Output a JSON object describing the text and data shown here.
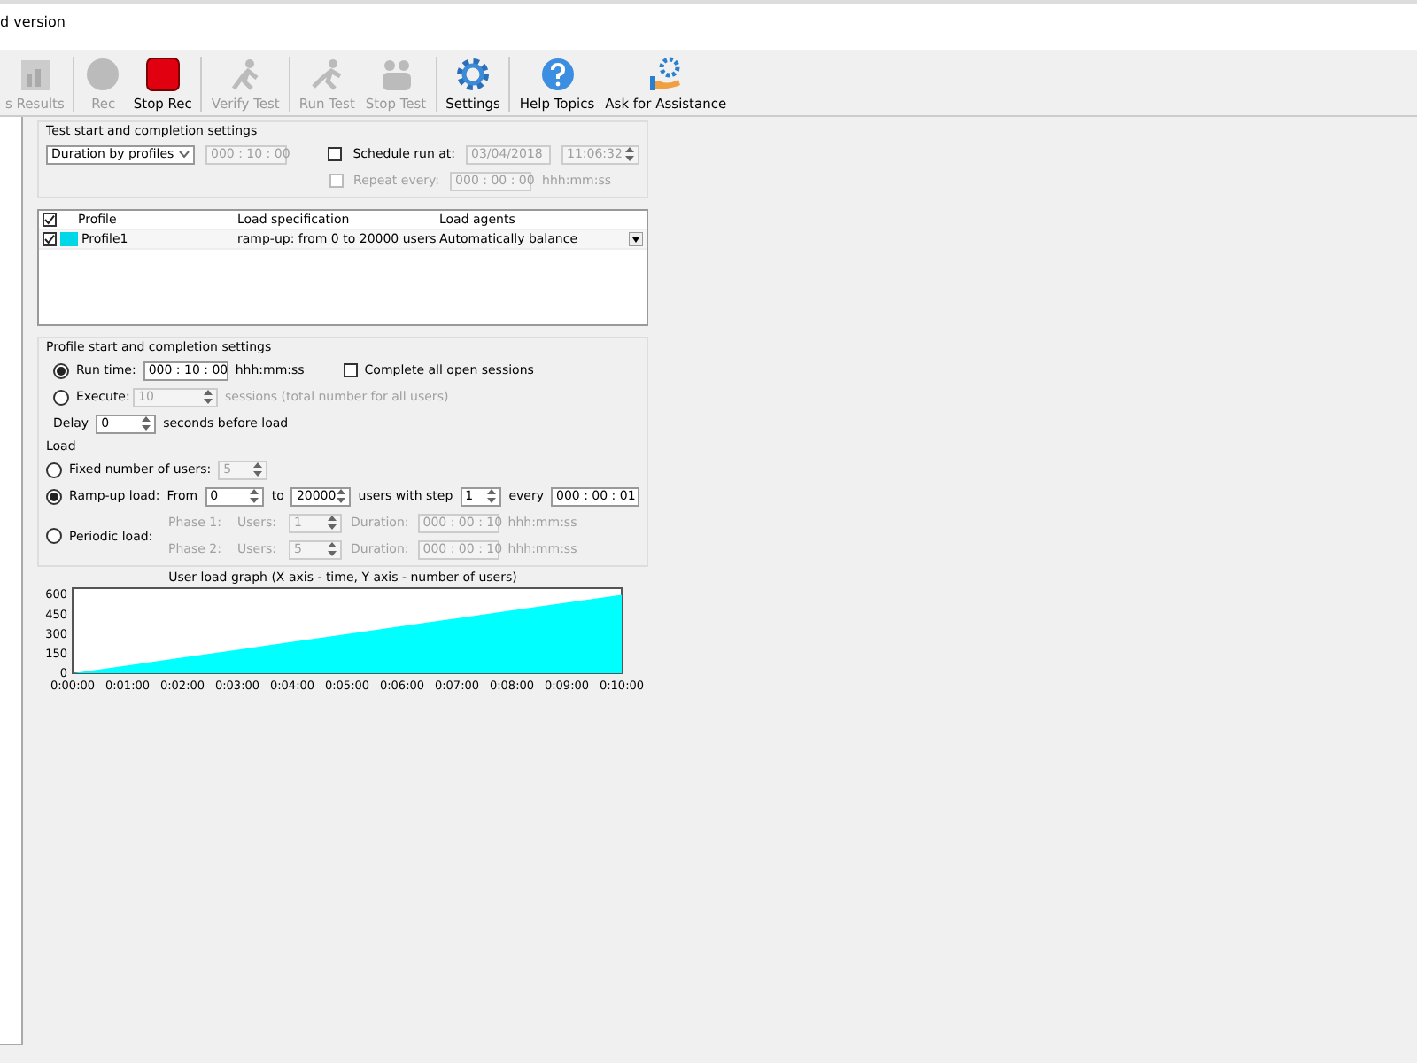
{
  "window": {
    "title": "d version"
  },
  "toolbar": [
    {
      "label": "s Results",
      "kind": "results",
      "disabled": true
    },
    {
      "label": "Rec",
      "kind": "rec",
      "disabled": true
    },
    {
      "label": "Stop Rec",
      "kind": "stop",
      "disabled": false
    },
    {
      "label": "Verify Test",
      "kind": "verify",
      "disabled": true
    },
    {
      "label": "Run Test",
      "kind": "run",
      "disabled": true
    },
    {
      "label": "Stop Test",
      "kind": "stoptest",
      "disabled": true
    },
    {
      "label": "Settings",
      "kind": "settings",
      "disabled": false
    },
    {
      "label": "Help Topics",
      "kind": "help",
      "disabled": false
    },
    {
      "label": "Ask for Assistance",
      "kind": "assist",
      "disabled": false
    }
  ],
  "test_settings": {
    "heading": "Test start and completion settings",
    "duration_mode": "Duration by profiles",
    "duration": "000 : 10 : 00",
    "schedule": {
      "label": "Schedule run at:",
      "checked": false,
      "date": "03/04/2018",
      "time": "11:06:32"
    },
    "repeat": {
      "label": "Repeat every:",
      "checked": false,
      "value": "000 : 00 : 00",
      "unit": "hhh:mm:ss"
    }
  },
  "profiles": {
    "header_checked": true,
    "columns": [
      "Profile",
      "Load specification",
      "Load agents"
    ],
    "rows": [
      {
        "checked": true,
        "color": "#00d8e8",
        "name": "Profile1",
        "spec": "ramp-up: from 0 to 20000 users",
        "agents": "Automatically balance"
      }
    ]
  },
  "profile_settings": {
    "heading": "Profile start and completion settings",
    "run_time": {
      "label": "Run time:",
      "selected": true,
      "value": "000 : 10 : 00",
      "unit": "hhh:mm:ss"
    },
    "complete": {
      "label": "Complete all open sessions",
      "checked": false
    },
    "execute": {
      "label": "Execute:",
      "selected": false,
      "value": "10",
      "unit": "sessions (total number for all users)"
    },
    "delay": {
      "label": "Delay",
      "value": "0",
      "unit": "seconds before load"
    }
  },
  "load": {
    "heading": "Load",
    "fixed": {
      "label": "Fixed number of users:",
      "selected": false,
      "value": "5"
    },
    "rampup": {
      "label": "Ramp-up load:",
      "selected": true,
      "from_label": "From",
      "from": "0",
      "to_label": "to",
      "to": "20000",
      "step_label": "users with step",
      "step": "1",
      "every_label": "every",
      "every": "000 : 00 : 01"
    },
    "periodic": {
      "label": "Periodic load:",
      "selected": false,
      "phases": [
        {
          "label": "Phase 1:",
          "users_label": "Users:",
          "users": "1",
          "duration_label": "Duration:",
          "duration": "000 : 00 : 10",
          "unit": "hhh:mm:ss"
        },
        {
          "label": "Phase 2:",
          "users_label": "Users:",
          "users": "5",
          "duration_label": "Duration:",
          "duration": "000 : 00 : 10",
          "unit": "hhh:mm:ss"
        }
      ]
    }
  },
  "graph": {
    "chart_data": {
      "type": "area",
      "title": "User load graph (X axis - time, Y axis - number of users)",
      "categories": [
        "0:00:00",
        "0:01:00",
        "0:02:00",
        "0:03:00",
        "0:04:00",
        "0:05:00",
        "0:06:00",
        "0:07:00",
        "0:08:00",
        "0:09:00",
        "0:10:00"
      ],
      "series": [
        {
          "color": "#00ffff",
          "values": [
            0,
            60,
            120,
            180,
            240,
            300,
            360,
            420,
            480,
            540,
            600
          ]
        }
      ],
      "ylim": [
        0,
        650
      ],
      "yticks": [
        0,
        150,
        300,
        450,
        600
      ]
    }
  }
}
